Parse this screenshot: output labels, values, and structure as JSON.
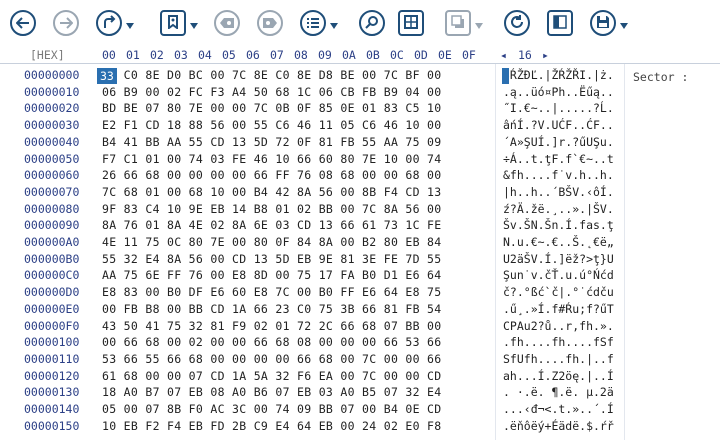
{
  "toolbar": {
    "buttons": [
      {
        "name": "back-button",
        "icon": "arrow-left-icon"
      },
      {
        "name": "forward-button",
        "icon": "arrow-right-icon"
      },
      {
        "name": "goto-button",
        "icon": "redo-arrow-icon"
      },
      {
        "name": "bookmark-button",
        "icon": "bookmark-icon"
      },
      {
        "name": "prev-bookmark-button",
        "icon": "tag-left-icon"
      },
      {
        "name": "next-bookmark-button",
        "icon": "tag-right-icon"
      },
      {
        "name": "list-button",
        "icon": "list-icon"
      },
      {
        "name": "search-button",
        "icon": "search-icon"
      },
      {
        "name": "view-button",
        "icon": "grid-icon"
      },
      {
        "name": "copy-button",
        "icon": "copy-icon"
      },
      {
        "name": "refresh-button",
        "icon": "refresh-icon"
      },
      {
        "name": "panel-button",
        "icon": "panel-icon"
      },
      {
        "name": "save-button",
        "icon": "save-icon"
      }
    ],
    "accent": "#1f4e79",
    "disabled_color": "#9aa6b2"
  },
  "ruler": {
    "hex_label": "[HEX]",
    "columns": [
      "00",
      "01",
      "02",
      "03",
      "04",
      "05",
      "06",
      "07",
      "08",
      "09",
      "0A",
      "0B",
      "0C",
      "0D",
      "0E",
      "0F"
    ],
    "width_prev": "◂",
    "width_value": "16",
    "width_next": "▸"
  },
  "selection": {
    "value": "33",
    "color": "#2a6fb0"
  },
  "sector_label": "Sector :",
  "rows": [
    {
      "addr": "00000000",
      "hex": "33 C0 8E D0 BC 00 7C 8E C0 8E D8 BE 00 7C BF 00",
      "ascii": "3ŔŽĐĽ.|ŽŔŽŘI.|ż."
    },
    {
      "addr": "00000010",
      "hex": "06 B9 00 02 FC F3 A4 50 68 1C 06 CB FB B9 04 00",
      "ascii": ".ą..üó¤Ph..Ëűą.."
    },
    {
      "addr": "00000020",
      "hex": "BD BE 07 80 7E 00 00 7C 0B 0F 85 0E 01 83 C5 10",
      "ascii": "˝I.€~..|.....?Ĺ."
    },
    {
      "addr": "00000030",
      "hex": "E2 F1 CD 18 88 56 00 55 C6 46 11 05 C6 46 10 00",
      "ascii": "âńÍ.?V.UĆF..ĆF.."
    },
    {
      "addr": "00000040",
      "hex": "B4 41 BB AA 55 CD 13 5D 72 0F 81 FB 55 AA 75 09",
      "ascii": "´A»ŞUÍ.]r.?űUŞu."
    },
    {
      "addr": "00000050",
      "hex": "F7 C1 01 00 74 03 FE 46 10 66 60 80 7E 10 00 74",
      "ascii": "÷Á..t.ţF.f`€~..t"
    },
    {
      "addr": "00000060",
      "hex": "26 66 68 00 00 00 00 66 FF 76 08 68 00 00 68 00",
      "ascii": "&fh....f˙v.h..h."
    },
    {
      "addr": "00000070",
      "hex": "7C 68 01 00 68 10 00 B4 42 8A 56 00 8B F4 CD 13",
      "ascii": "|h..h..´BŠV.‹ôÍ."
    },
    {
      "addr": "00000080",
      "hex": "9F 83 C4 10 9E EB 14 B8 01 02 BB 00 7C 8A 56 00",
      "ascii": "ź?Ä.žë.¸..».|ŠV."
    },
    {
      "addr": "00000090",
      "hex": "8A 76 01 8A 4E 02 8A 6E 03 CD 13 66 61 73 1C FE",
      "ascii": "Šv.ŠN.Šn.Í.fas.ţ"
    },
    {
      "addr": "000000A0",
      "hex": "4E 11 75 0C 80 7E 00 80 0F 84 8A 00 B2 80 EB 84",
      "ascii": "N.u.€~.€..Š.˛€ë„"
    },
    {
      "addr": "000000B0",
      "hex": "55 32 E4 8A 56 00 CD 13 5D EB 9E 81 3E FE 7D 55",
      "ascii": "U2äŠV.Í.]ëž?>ţ}U"
    },
    {
      "addr": "000000C0",
      "hex": "AA 75 6E FF 76 00 E8 8D 00 75 17 FA B0 D1 E6 64",
      "ascii": "Şun˙v.čŤ.u.ú°Ńćd"
    },
    {
      "addr": "000000D0",
      "hex": "E8 83 00 B0 DF E6 60 E8 7C 00 B0 FF E6 64 E8 75",
      "ascii": "č?.°ßć`č|.°˙ćdču"
    },
    {
      "addr": "000000E0",
      "hex": "00 FB B8 00 BB CD 1A 66 23 C0 75 3B 66 81 FB 54",
      "ascii": ".ű¸.»Í.f#Ŕu;f?űT"
    },
    {
      "addr": "000000F0",
      "hex": "43 50 41 75 32 81 F9 02 01 72 2C 66 68 07 BB 00",
      "ascii": "CPAu2?ů..r,fh.»."
    },
    {
      "addr": "00000100",
      "hex": "00 66 68 00 02 00 00 66 68 08 00 00 00 66 53 66",
      "ascii": ".fh....fh....fSf"
    },
    {
      "addr": "00000110",
      "hex": "53 66 55 66 68 00 00 00 00 66 68 00 7C 00 00 66",
      "ascii": "SfUfh....fh.|..f"
    },
    {
      "addr": "00000120",
      "hex": "61 68 00 00 07 CD 1A 5A 32 F6 EA 00 7C 00 00 CD",
      "ascii": "ah...Í.Z2öę.|..Í"
    },
    {
      "addr": "00000130",
      "hex": "18 A0 B7 07 EB 08 A0 B6 07 EB 03 A0 B5 07 32 E4",
      "ascii": ". ·.ë. ¶.ë. µ.2ä"
    },
    {
      "addr": "00000140",
      "hex": "05 00 07 8B F0 AC 3C 00 74 09 BB 07 00 B4 0E CD",
      "ascii": "...‹đ¬<.t.»..´.Í"
    },
    {
      "addr": "00000150",
      "hex": "10 EB F2 F4 EB FD 2B C9 E4 64 EB 00 24 02 E0 F8",
      "ascii": ".ëňôëý+Éädë.$.ŕř"
    }
  ]
}
